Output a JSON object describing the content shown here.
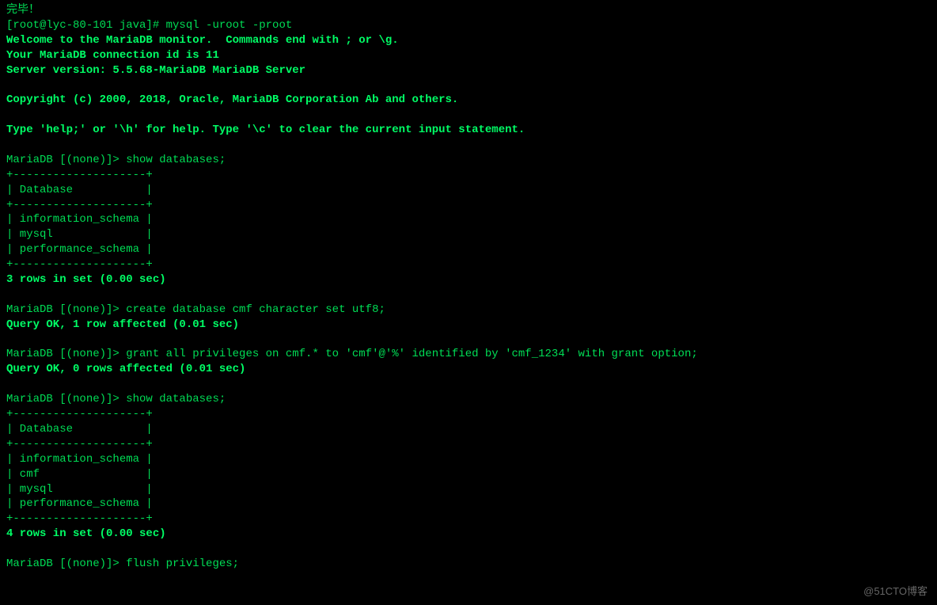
{
  "lines": [
    {
      "text": "完毕！",
      "class": "normal"
    },
    {
      "text": "[root@lyc-80-101 java]# mysql -uroot -proot",
      "class": "normal"
    },
    {
      "text": "Welcome to the MariaDB monitor.  Commands end with ; or \\g.",
      "class": "bold"
    },
    {
      "text": "Your MariaDB connection id is 11",
      "class": "bold"
    },
    {
      "text": "Server version: 5.5.68-MariaDB MariaDB Server",
      "class": "bold"
    },
    {
      "text": " ",
      "class": "normal"
    },
    {
      "text": "Copyright (c) 2000, 2018, Oracle, MariaDB Corporation Ab and others.",
      "class": "bold"
    },
    {
      "text": " ",
      "class": "normal"
    },
    {
      "text": "Type 'help;' or '\\h' for help. Type '\\c' to clear the current input statement.",
      "class": "bold"
    },
    {
      "text": " ",
      "class": "normal"
    },
    {
      "text": "MariaDB [(none)]> show databases;",
      "class": "normal"
    },
    {
      "text": "+--------------------+",
      "class": "normal"
    },
    {
      "text": "| Database           |",
      "class": "normal"
    },
    {
      "text": "+--------------------+",
      "class": "normal"
    },
    {
      "text": "| information_schema |",
      "class": "normal"
    },
    {
      "text": "| mysql              |",
      "class": "normal"
    },
    {
      "text": "| performance_schema |",
      "class": "normal"
    },
    {
      "text": "+--------------------+",
      "class": "normal"
    },
    {
      "text": "3 rows in set (0.00 sec)",
      "class": "bold"
    },
    {
      "text": " ",
      "class": "normal"
    },
    {
      "text": "MariaDB [(none)]> create database cmf character set utf8;",
      "class": "normal"
    },
    {
      "text": "Query OK, 1 row affected (0.01 sec)",
      "class": "bold"
    },
    {
      "text": " ",
      "class": "normal"
    },
    {
      "text": "MariaDB [(none)]> grant all privileges on cmf.* to 'cmf'@'%' identified by 'cmf_1234' with grant option;",
      "class": "normal"
    },
    {
      "text": "Query OK, 0 rows affected (0.01 sec)",
      "class": "bold"
    },
    {
      "text": " ",
      "class": "normal"
    },
    {
      "text": "MariaDB [(none)]> show databases;",
      "class": "normal"
    },
    {
      "text": "+--------------------+",
      "class": "normal"
    },
    {
      "text": "| Database           |",
      "class": "normal"
    },
    {
      "text": "+--------------------+",
      "class": "normal"
    },
    {
      "text": "| information_schema |",
      "class": "normal"
    },
    {
      "text": "| cmf                |",
      "class": "normal"
    },
    {
      "text": "| mysql              |",
      "class": "normal"
    },
    {
      "text": "| performance_schema |",
      "class": "normal"
    },
    {
      "text": "+--------------------+",
      "class": "normal"
    },
    {
      "text": "4 rows in set (0.00 sec)",
      "class": "bold"
    },
    {
      "text": " ",
      "class": "normal"
    },
    {
      "text": "MariaDB [(none)]> flush privileges;",
      "class": "normal"
    }
  ],
  "watermark": "@51CTO博客"
}
